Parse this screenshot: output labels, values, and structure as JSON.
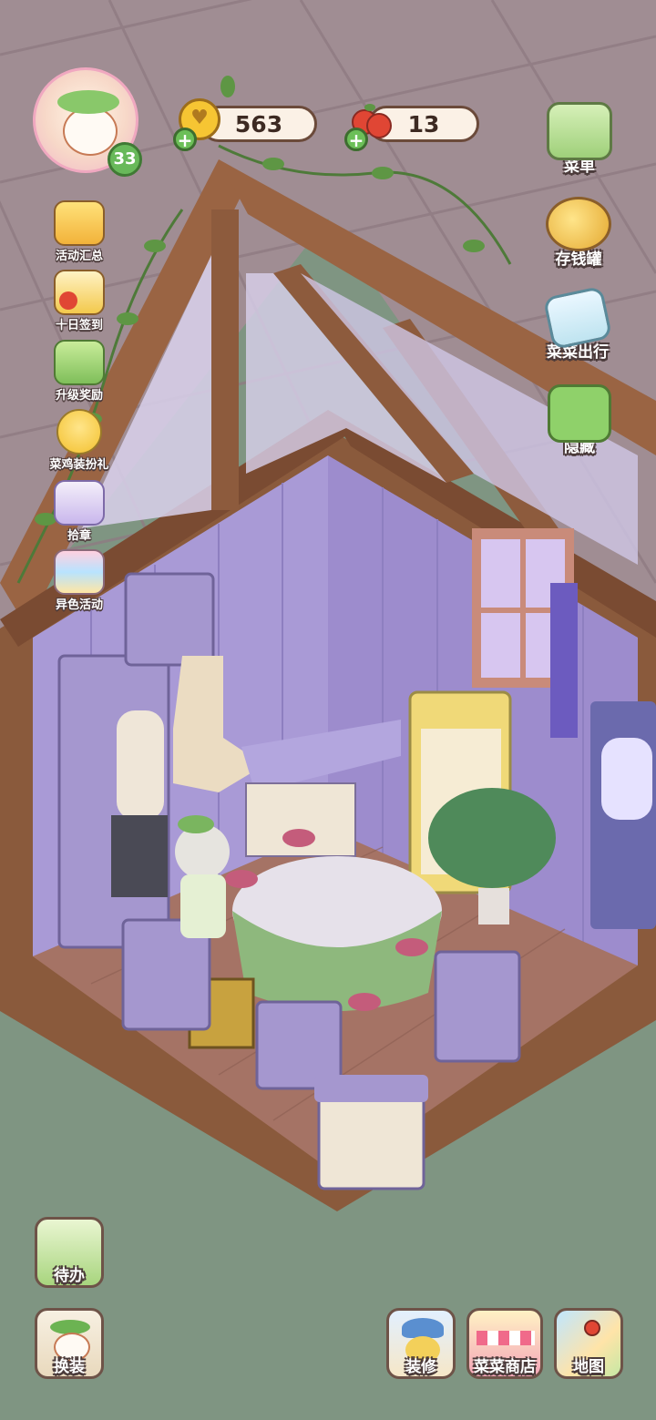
{
  "hud": {
    "level": "33",
    "coins": "563",
    "tomatoes": "13"
  },
  "left_events": [
    {
      "label": "活动汇总",
      "icon": "crown-icon"
    },
    {
      "label": "十日签到",
      "icon": "calendar-gift-icon"
    },
    {
      "label": "升级奖励",
      "icon": "level-up-icon"
    },
    {
      "label": "菜鸡装扮礼",
      "icon": "chick-icon"
    },
    {
      "label": "拾章",
      "icon": "badge-book-icon"
    },
    {
      "label": "异色活动",
      "icon": "rainbow-box-icon"
    }
  ],
  "right_menu": [
    {
      "label": "菜单",
      "icon": "menu-box-icon"
    },
    {
      "label": "存钱罐",
      "icon": "piggy-bank-icon"
    },
    {
      "label": "菜菜出行",
      "icon": "travel-card-icon"
    },
    {
      "label": "隐藏",
      "icon": "hide-frame-icon"
    }
  ],
  "bottom_left": [
    {
      "label": "待办",
      "icon": "todo-list-icon"
    },
    {
      "label": "换装",
      "icon": "wardrobe-icon"
    }
  ],
  "bottom_right": [
    {
      "label": "装修",
      "icon": "decorate-icon"
    },
    {
      "label": "菜菜商店",
      "icon": "shop-icon"
    },
    {
      "label": "地图",
      "icon": "map-icon"
    }
  ],
  "colors": {
    "wood": "#8a5a3c",
    "wall": "#a99ad6",
    "grass": "#7f9582",
    "roof": "#a08d93"
  }
}
